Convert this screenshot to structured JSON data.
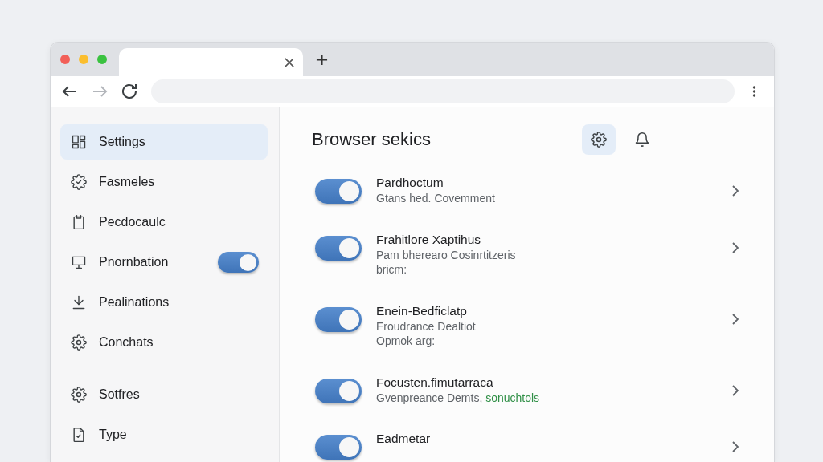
{
  "window_buttons": [
    {
      "color": "#f25f58"
    },
    {
      "color": "#fbbe2e"
    },
    {
      "color": "#3ac240"
    }
  ],
  "tabs": [
    {
      "selected": true
    }
  ],
  "toolbar": {
    "nav_buttons": [
      {
        "kind": "back",
        "disabled": false
      },
      {
        "kind": "forward",
        "disabled": true
      },
      {
        "kind": "reload",
        "disabled": false
      }
    ]
  },
  "sidebar": {
    "groups": [
      {
        "items": [
          {
            "kind": "link",
            "label": "Settings",
            "selected": true
          },
          {
            "kind": "link",
            "label": "Fasmeles",
            "selected": false
          },
          {
            "kind": "link",
            "label": "Pecdocaulc",
            "selected": false
          },
          {
            "kind": "toggle",
            "label": "Pnornbation",
            "selected": false,
            "on": true
          },
          {
            "kind": "link",
            "label": "Pealinations",
            "selected": false
          },
          {
            "kind": "link",
            "label": "Conchats",
            "selected": false
          }
        ]
      },
      {
        "items": [
          {
            "kind": "link",
            "label": "Sotfres",
            "selected": false
          },
          {
            "kind": "link",
            "label": "Type",
            "selected": false
          }
        ]
      }
    ]
  },
  "main": {
    "title": "Browser sekics",
    "header_buttons": [
      {
        "kind": "settings",
        "selected": true
      },
      {
        "kind": "notifications",
        "selected": false
      }
    ],
    "rows": [
      {
        "title": "Pardhoctum",
        "description": [
          "Gtans hed. Covemment"
        ],
        "on": true
      },
      {
        "title": "Frahitlore Xaptihus",
        "description": [
          "Pam bherearo Cosinrtitzeris",
          "bricm:"
        ],
        "on": true
      },
      {
        "title": "Enein-Bedficlatp",
        "description": [
          "Eroudrance Dealtiot",
          "Opmok arg:"
        ],
        "on": true
      },
      {
        "title": "Focusten.fimutarraca",
        "description": [
          "Gvenpreance Demts,"
        ],
        "link": "sonuchtols",
        "on": true
      },
      {
        "title": "Eadmetar",
        "on": true
      }
    ]
  }
}
